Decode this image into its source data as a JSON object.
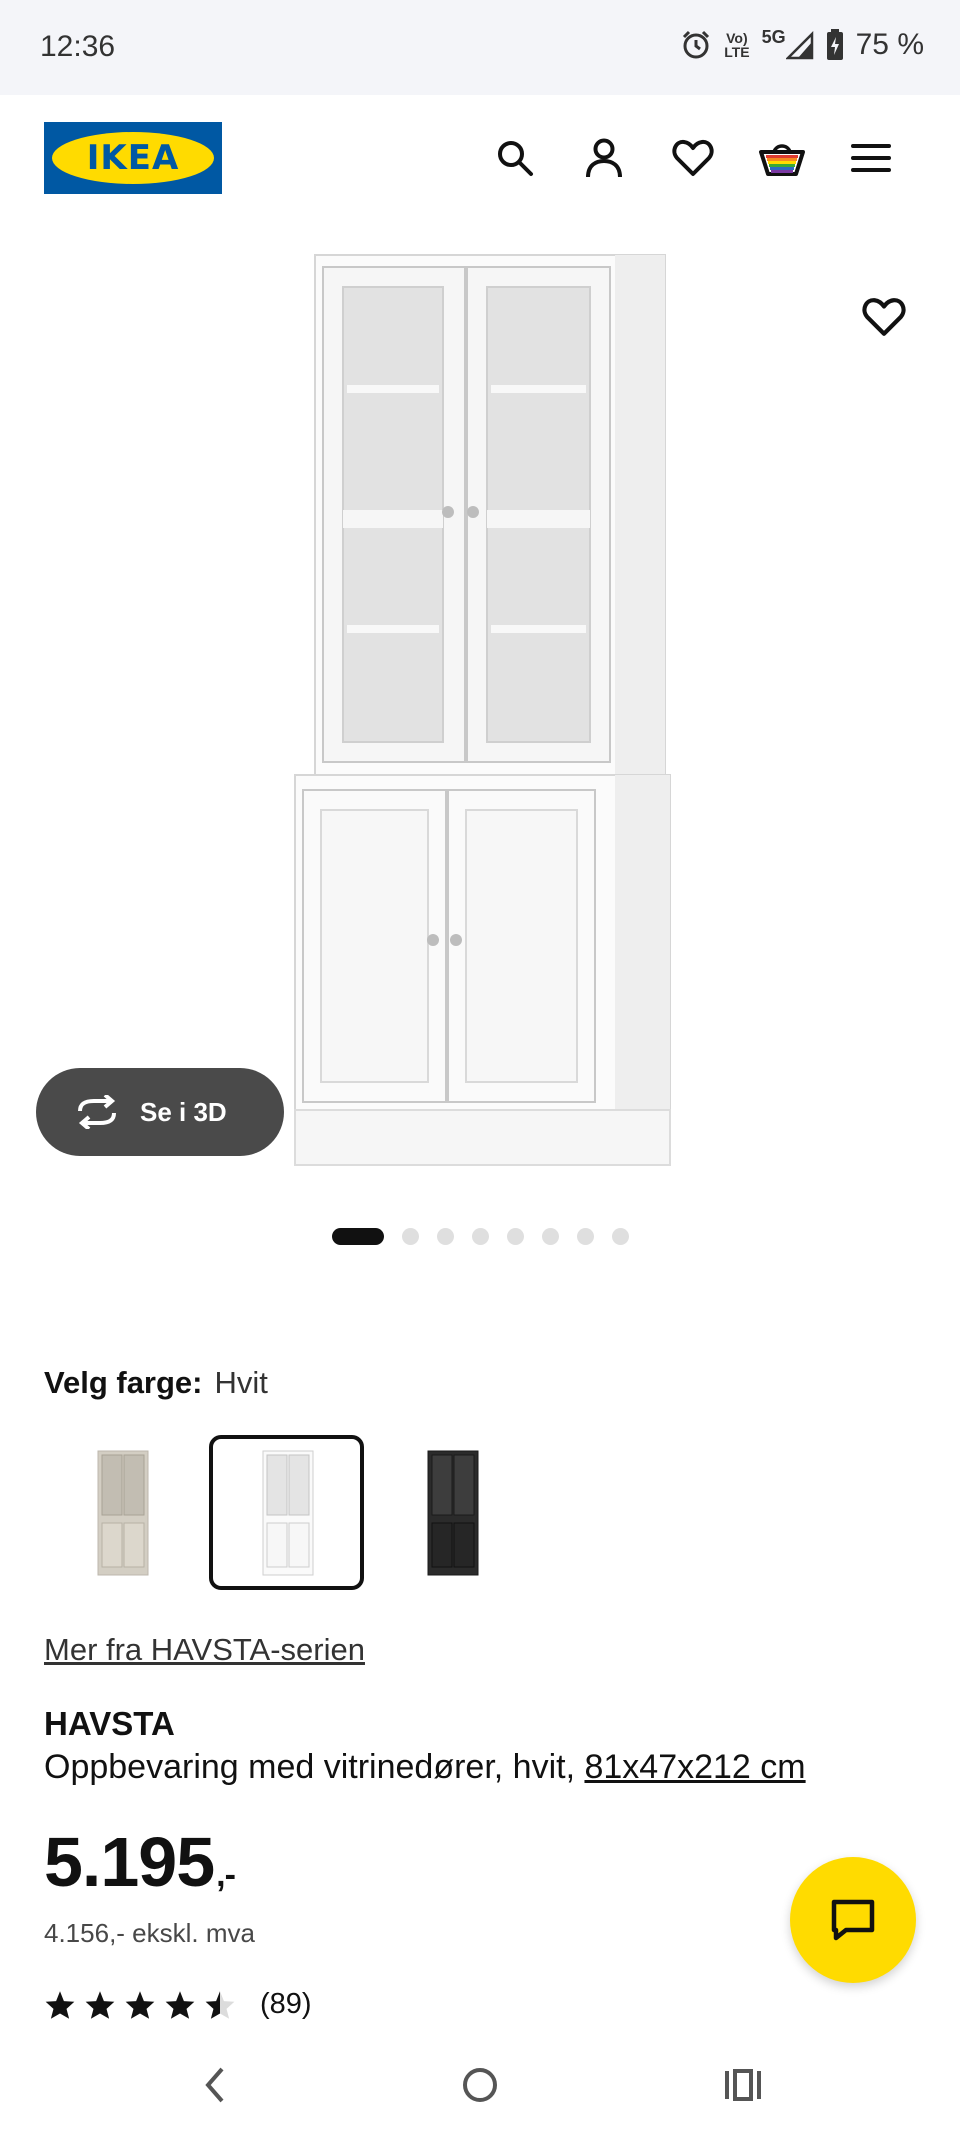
{
  "status_bar": {
    "time": "12:36",
    "volte_top": "Vo)",
    "volte_bottom": "LTE",
    "network": "5G",
    "battery": "75 %"
  },
  "header": {
    "logo_text": "IKEA",
    "brand_colors": {
      "blue": "#0058a3",
      "yellow": "#ffdb00"
    },
    "icons": [
      "search-icon",
      "account-icon",
      "favourites-icon",
      "cart-icon",
      "menu-icon"
    ]
  },
  "gallery": {
    "view_3d_label": "Se i 3D",
    "image_count": 8,
    "active_index": 0
  },
  "color_picker": {
    "label": "Velg farge:",
    "selected_value": "Hvit",
    "options": [
      "beige",
      "white",
      "black"
    ],
    "selected_index": 1
  },
  "series_link": "Mer fra HAVSTA-serien",
  "product": {
    "name": "HAVSTA",
    "description": "Oppbevaring med vitrinedører, hvit, ",
    "dimensions": "81x47x212 cm",
    "price_main": "5.195",
    "price_suffix": ",-",
    "price_excl_vat": "4.156,- ekskl. mva",
    "rating": 4.5,
    "rating_count": "(89)"
  }
}
